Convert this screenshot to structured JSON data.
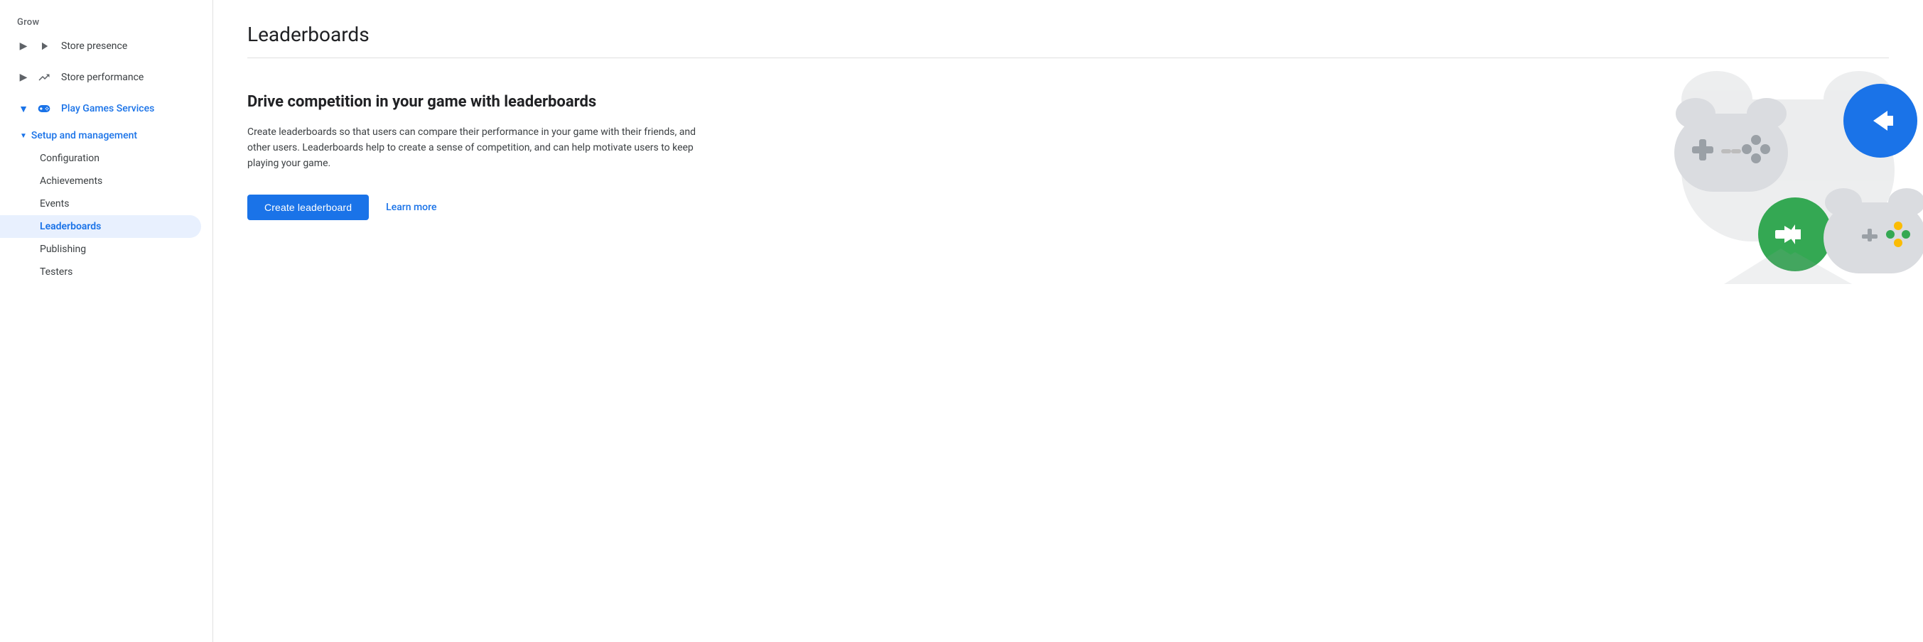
{
  "sidebar": {
    "section_label": "Grow",
    "items": [
      {
        "id": "store-presence",
        "label": "Store presence",
        "icon": "play-icon",
        "expandable": true,
        "expanded": false,
        "indent": 0
      },
      {
        "id": "store-performance",
        "label": "Store performance",
        "icon": "trending-icon",
        "expandable": true,
        "expanded": false,
        "indent": 0
      },
      {
        "id": "play-games-services",
        "label": "Play Games Services",
        "icon": "gamepad-icon",
        "expandable": true,
        "expanded": true,
        "indent": 0,
        "blue": true
      },
      {
        "id": "setup-management",
        "label": "Setup and management",
        "expandable": true,
        "expanded": true,
        "indent": 1,
        "blue": true
      }
    ],
    "sub_items": [
      {
        "id": "configuration",
        "label": "Configuration",
        "active": false
      },
      {
        "id": "achievements",
        "label": "Achievements",
        "active": false
      },
      {
        "id": "events",
        "label": "Events",
        "active": false
      },
      {
        "id": "leaderboards",
        "label": "Leaderboards",
        "active": true
      },
      {
        "id": "publishing",
        "label": "Publishing",
        "active": false
      },
      {
        "id": "testers",
        "label": "Testers",
        "active": false
      }
    ]
  },
  "main": {
    "title": "Leaderboards",
    "heading": "Drive competition in your game with leaderboards",
    "description": "Create leaderboards so that users can compare their performance in your game with their friends, and other users. Leaderboards help to create a sense of competition, and can help motivate users to keep playing your game.",
    "create_button_label": "Create leaderboard",
    "learn_more_label": "Learn more"
  },
  "colors": {
    "blue": "#1a73e8",
    "green": "#34a853",
    "yellow": "#fbbc04",
    "gray_light": "#dadce0",
    "gray_medium": "#9aa0a6",
    "white": "#ffffff"
  }
}
